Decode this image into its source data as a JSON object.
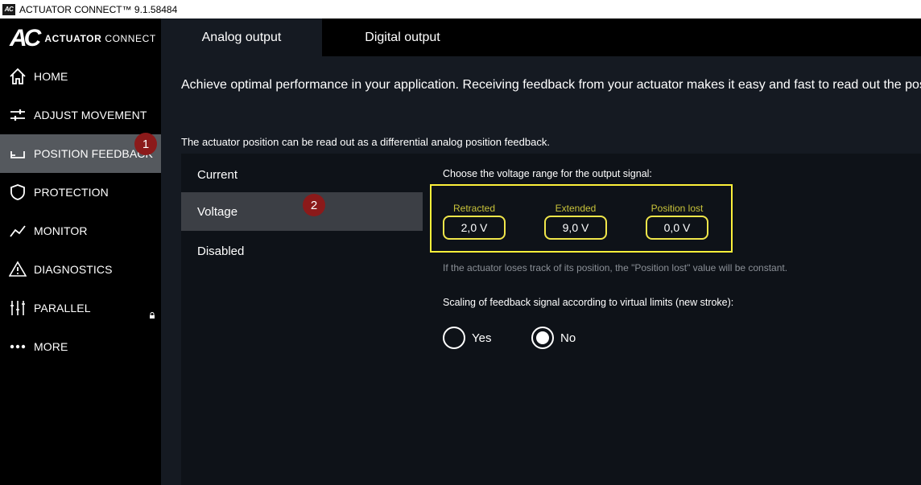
{
  "window": {
    "title": "ACTUATOR CONNECT™ 9.1.58484",
    "app_icon_text": "AC"
  },
  "logo": {
    "mark": "AC",
    "word_bold": "ACTUATOR",
    "word_light": "CONNECT"
  },
  "sidebar": {
    "items": [
      {
        "label": "HOME",
        "icon": "home-icon"
      },
      {
        "label": "ADJUST MOVEMENT",
        "icon": "adjust-sliders-icon"
      },
      {
        "label": "POSITION FEEDBACK",
        "icon": "position-feedback-icon",
        "active": true
      },
      {
        "label": "PROTECTION",
        "icon": "shield-icon"
      },
      {
        "label": "MONITOR",
        "icon": "line-chart-icon"
      },
      {
        "label": "DIAGNOSTICS",
        "icon": "warning-triangle-icon"
      },
      {
        "label": "PARALLEL",
        "icon": "parallel-icon",
        "locked": true
      },
      {
        "label": "MORE",
        "icon": "more-dots-icon"
      }
    ]
  },
  "badges": {
    "first": "1",
    "second": "2"
  },
  "tabs": [
    {
      "label": "Analog output",
      "active": true
    },
    {
      "label": "Digital output",
      "active": false
    }
  ],
  "main": {
    "intro": "Achieve optimal performance in your application. Receiving feedback from your actuator makes it easy and fast to read out the pos",
    "subintro": "The actuator position can be read out as a differential analog position feedback."
  },
  "options": [
    {
      "label": "Current",
      "selected": false
    },
    {
      "label": "Voltage",
      "selected": true
    },
    {
      "label": "Disabled",
      "selected": false
    }
  ],
  "voltage": {
    "heading": "Choose the voltage range for the output signal:",
    "retracted_label": "Retracted",
    "retracted_value": "2,0 V",
    "extended_label": "Extended",
    "extended_value": "9,0 V",
    "lost_label": "Position lost",
    "lost_value": "0,0 V",
    "note": "If the actuator loses track of its position, the \"Position lost\" value will be constant."
  },
  "scaling": {
    "heading": "Scaling of feedback signal according to virtual limits (new stroke):",
    "yes_label": "Yes",
    "no_label": "No",
    "selected": "No"
  },
  "colors": {
    "highlight": "#fdf03a",
    "badge": "#8b1a1a",
    "active_nav": "#55595e",
    "background": "#151a22"
  }
}
